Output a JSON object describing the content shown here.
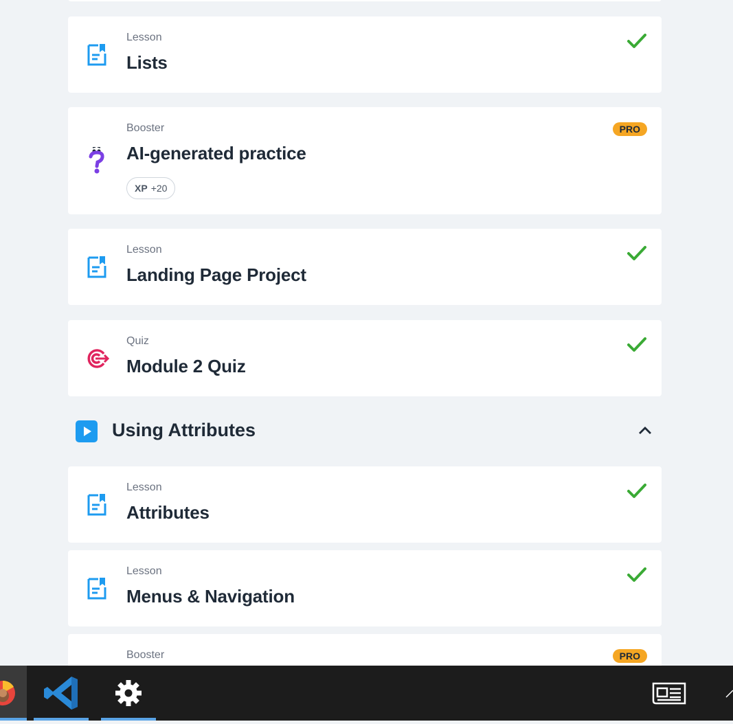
{
  "items": [
    {
      "kind": "Lesson",
      "title": "Lists",
      "status": "complete",
      "icon": "lesson-icon"
    },
    {
      "kind": "Booster",
      "title": "AI-generated practice",
      "badge": "PRO",
      "xp_label": "XP",
      "xp_value": "+20",
      "icon": "question-mark-icon"
    },
    {
      "kind": "Lesson",
      "title": "Landing Page Project",
      "status": "complete",
      "icon": "lesson-icon"
    },
    {
      "kind": "Quiz",
      "title": "Module 2 Quiz",
      "status": "complete",
      "icon": "target-icon"
    },
    {
      "kind": "Lesson",
      "title": "Attributes",
      "status": "complete",
      "icon": "lesson-icon"
    },
    {
      "kind": "Lesson",
      "title": "Menus & Navigation",
      "status": "complete",
      "icon": "lesson-icon"
    },
    {
      "kind": "Booster",
      "badge": "PRO",
      "icon": "question-mark-icon"
    }
  ],
  "section": {
    "title": "Using Attributes",
    "expanded": true
  },
  "colors": {
    "accent": "#1d9bf0",
    "check": "#3aaa35",
    "pro": "#f5a623",
    "quiz": "#e0245e",
    "booster": "#7b3fe4"
  },
  "taskbar": {
    "apps": [
      "browser-icon",
      "vscode-icon",
      "settings-icon"
    ],
    "tray": [
      "news-icon",
      "chevron-up-icon"
    ]
  }
}
